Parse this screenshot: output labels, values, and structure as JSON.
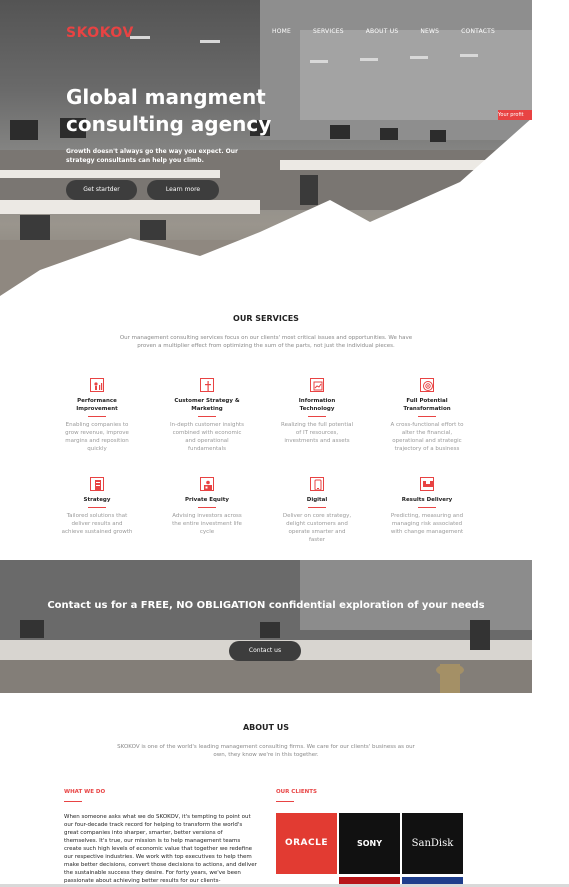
{
  "brand": {
    "logo": "SKOKOV"
  },
  "nav": [
    "HOME",
    "SERVICES",
    "ABOUT US",
    "NEWS",
    "CONTACTS"
  ],
  "hero": {
    "title": "Global mangment consulting agency",
    "subtitle": "Growth doesn't always go the way you expect. Our strategy consultants can help you climb.",
    "btn_start": "Get startder",
    "btn_more": "Learn more",
    "tag": "Your profit"
  },
  "services": {
    "title": "OUR SERVICES",
    "desc": "Our management consulting services focus on our clients' most critical issues and opportunities. We have proven a multiplier effect from optimizing the sum of the parts, not just the individual pieces.",
    "items": [
      {
        "icon": "people-chart-icon",
        "title": "Performance Improvement",
        "desc": "Enabling companies to grow revenue, improve margins and reposition quickly"
      },
      {
        "icon": "strategy-arrow-icon",
        "title": "Customer Strategy & Marketing",
        "desc": "In-depth customer insights combined with economic and operational fundamentals"
      },
      {
        "icon": "tech-chart-icon",
        "title": "Information Technology",
        "desc": "Realizing the full potential of IT resources, investments and assets"
      },
      {
        "icon": "target-icon",
        "title": "Full Potential Transformation",
        "desc": "A cross-functional effort to alter the financial, operational and strategic trajectory of a business"
      },
      {
        "icon": "chess-icon",
        "title": "Strategy",
        "desc": "Tailored solutions that deliver results and achieve sustained growth"
      },
      {
        "icon": "briefcase-people-icon",
        "title": "Private Equity",
        "desc": "Advising investors across the entire investment life cycle"
      },
      {
        "icon": "mobile-icon",
        "title": "Digital",
        "desc": "Deliver on core strategy, delight customers and operate smarter and faster"
      },
      {
        "icon": "handshake-icon",
        "title": "Results Delivery",
        "desc": "Predicting, measuring and managing risk associated with change management"
      }
    ]
  },
  "contact_band": {
    "title": "Contact us for a FREE, NO OBLIGATION confidential exploration of your needs",
    "button": "Contact us"
  },
  "about": {
    "title": "ABOUT US",
    "desc": "SKOKOV is one of the world's leading management consulting firms. We care for our clients' business as our own, they know we're in this together.",
    "what_we_do_head": "WHAT WE DO",
    "what_we_do_text": "When someone asks what we do SKOKOV, it's tempting to point out our four-decade track record for helping to transform the world's great companies into sharper, smarter, better versions of themselves. It's true, our mission is to help management teams create such high levels of economic value that together we redefine our respective industries. We work with top executives to help them make better decisions, convert those decisions to actions, and deliver the sustainable success they desire. For forty years, we've been passionate about achieving better results for our clients-",
    "clients_head": "OUR CLIENTS",
    "clients": [
      "ORACLE",
      "SONY",
      "SanDisk"
    ]
  },
  "colors": {
    "accent": "#e84343",
    "dark": "#3d3d3d"
  }
}
